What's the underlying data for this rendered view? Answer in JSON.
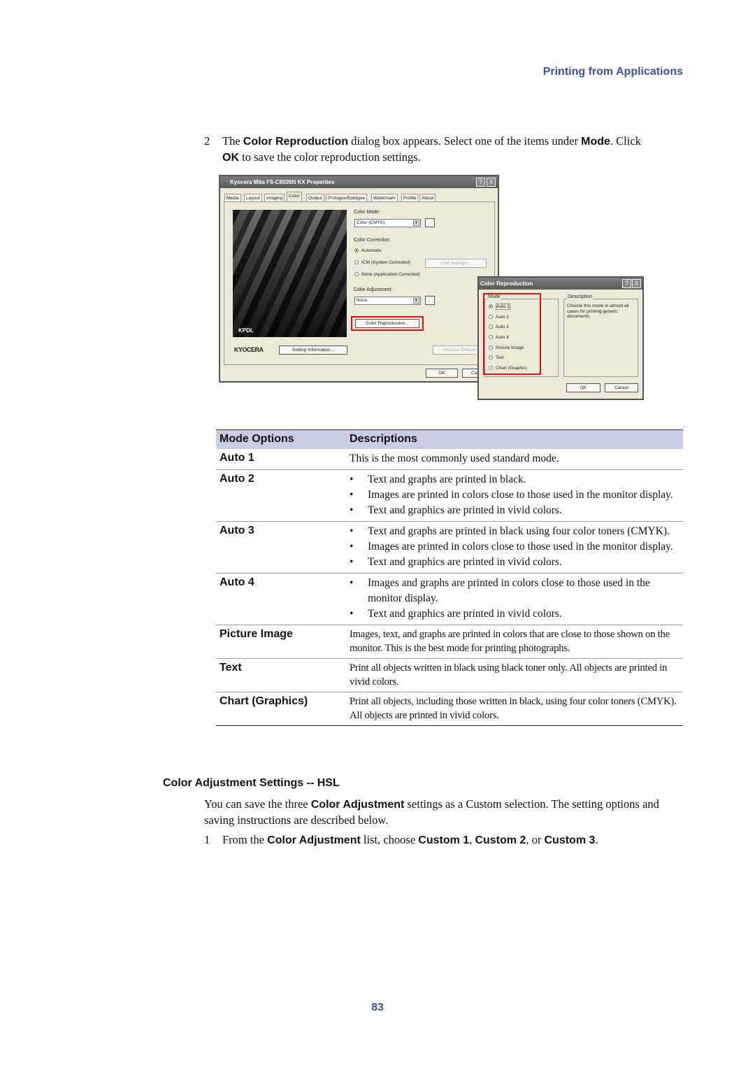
{
  "running_head": "Printing from Applications",
  "step2": {
    "num": "2",
    "parts": [
      "The ",
      "Color Reproduction",
      " dialog box appears. Select one of the items under ",
      "Mode",
      ". Click"
    ],
    "line2_bold": "OK",
    "line2_rest": " to save the color reproduction settings."
  },
  "screenshot": {
    "properties_dialog": {
      "title": "Kyocera Mita FS-C8026N KX Properties",
      "tabs": [
        "Media",
        "Layout",
        "Imaging",
        "Color",
        "Output",
        "Prologue/Epilogue",
        "Watermark",
        "Profile",
        "About"
      ],
      "active_tab": "Color",
      "image_label": "KPDL",
      "logo": "KYOCERA",
      "color_mode_label": "Color Mode:",
      "color_mode_value": "Color (CMYK)",
      "color_correction_label": "Color Correction:",
      "correction_options": [
        "Automatic",
        "ICM (System Corrected)",
        "None (Application Corrected)"
      ],
      "icm_settings_button": "ICM Settings...",
      "color_adjustment_label": "Color Adjustment:",
      "color_adjustment_value": "None",
      "color_reproduction_button": "Color Reproduction...",
      "setting_info_button": "Setting Information...",
      "restore_defaults_button": "Restore Defaults",
      "ok_button": "OK",
      "cancel_button": "Ca",
      "help_button": "?",
      "close_button": "X"
    },
    "color_repro_dialog": {
      "title": "Color Reproduction",
      "mode_label": "Mode",
      "modes": [
        "Auto 1",
        "Auto 2",
        "Auto 3",
        "Auto 4",
        "Picture Image",
        "Text",
        "Chart (Graphic)"
      ],
      "selected_mode": "Auto 1",
      "description_label": "Description",
      "description": "Choose this mode in almost all cases for printing generic documents.",
      "ok_button": "OK",
      "cancel_button": "Cancel",
      "help_button": "?",
      "close_button": "X",
      "highlight_color": "#e01010"
    }
  },
  "table": {
    "headers": [
      "Mode Options",
      "Descriptions"
    ],
    "header_bg": "#c8cde3",
    "rows": [
      {
        "option": "Auto 1",
        "text": "This is the most commonly used standard mode."
      },
      {
        "option": "Auto 2",
        "bullets": [
          "Text and graphs are printed in black.",
          "Images are printed in colors close to those used in the monitor display.",
          "Text and graphics are printed in vivid colors."
        ]
      },
      {
        "option": "Auto 3",
        "bullets": [
          "Text and graphs are printed in black using four color toners (CMYK).",
          "Images are printed in colors close to those used in the monitor display.",
          "Text and graphics are printed in vivid colors."
        ]
      },
      {
        "option": "Auto 4",
        "bullets": [
          "Images and graphs are printed in colors close to those used in the monitor display.",
          "Text and graphics are printed in vivid colors."
        ]
      },
      {
        "option": "Picture Image",
        "text": "Images, text, and graphs are printed in colors that are close to those shown on the monitor. This is the best mode for printing photographs."
      },
      {
        "option": "Text",
        "text": "Print all objects written in black using black toner only. All objects are printed in vivid colors."
      },
      {
        "option": "Chart (Graphics)",
        "text": "Print all objects, including those written in black, using four color toners (CMYK). All objects are printed in vivid colors."
      }
    ]
  },
  "section": {
    "heading": "Color Adjustment Settings -- HSL",
    "para_parts": [
      "You can save the three ",
      "Color Adjustment",
      " settings as a Custom selection. The setting options and saving instructions are described below."
    ],
    "step1": {
      "num": "1",
      "parts": [
        "From the ",
        "Color Adjustment",
        " list, choose ",
        "Custom 1",
        ", ",
        "Custom 2",
        ", or ",
        "Custom 3",
        "."
      ]
    }
  },
  "page_number": "83"
}
